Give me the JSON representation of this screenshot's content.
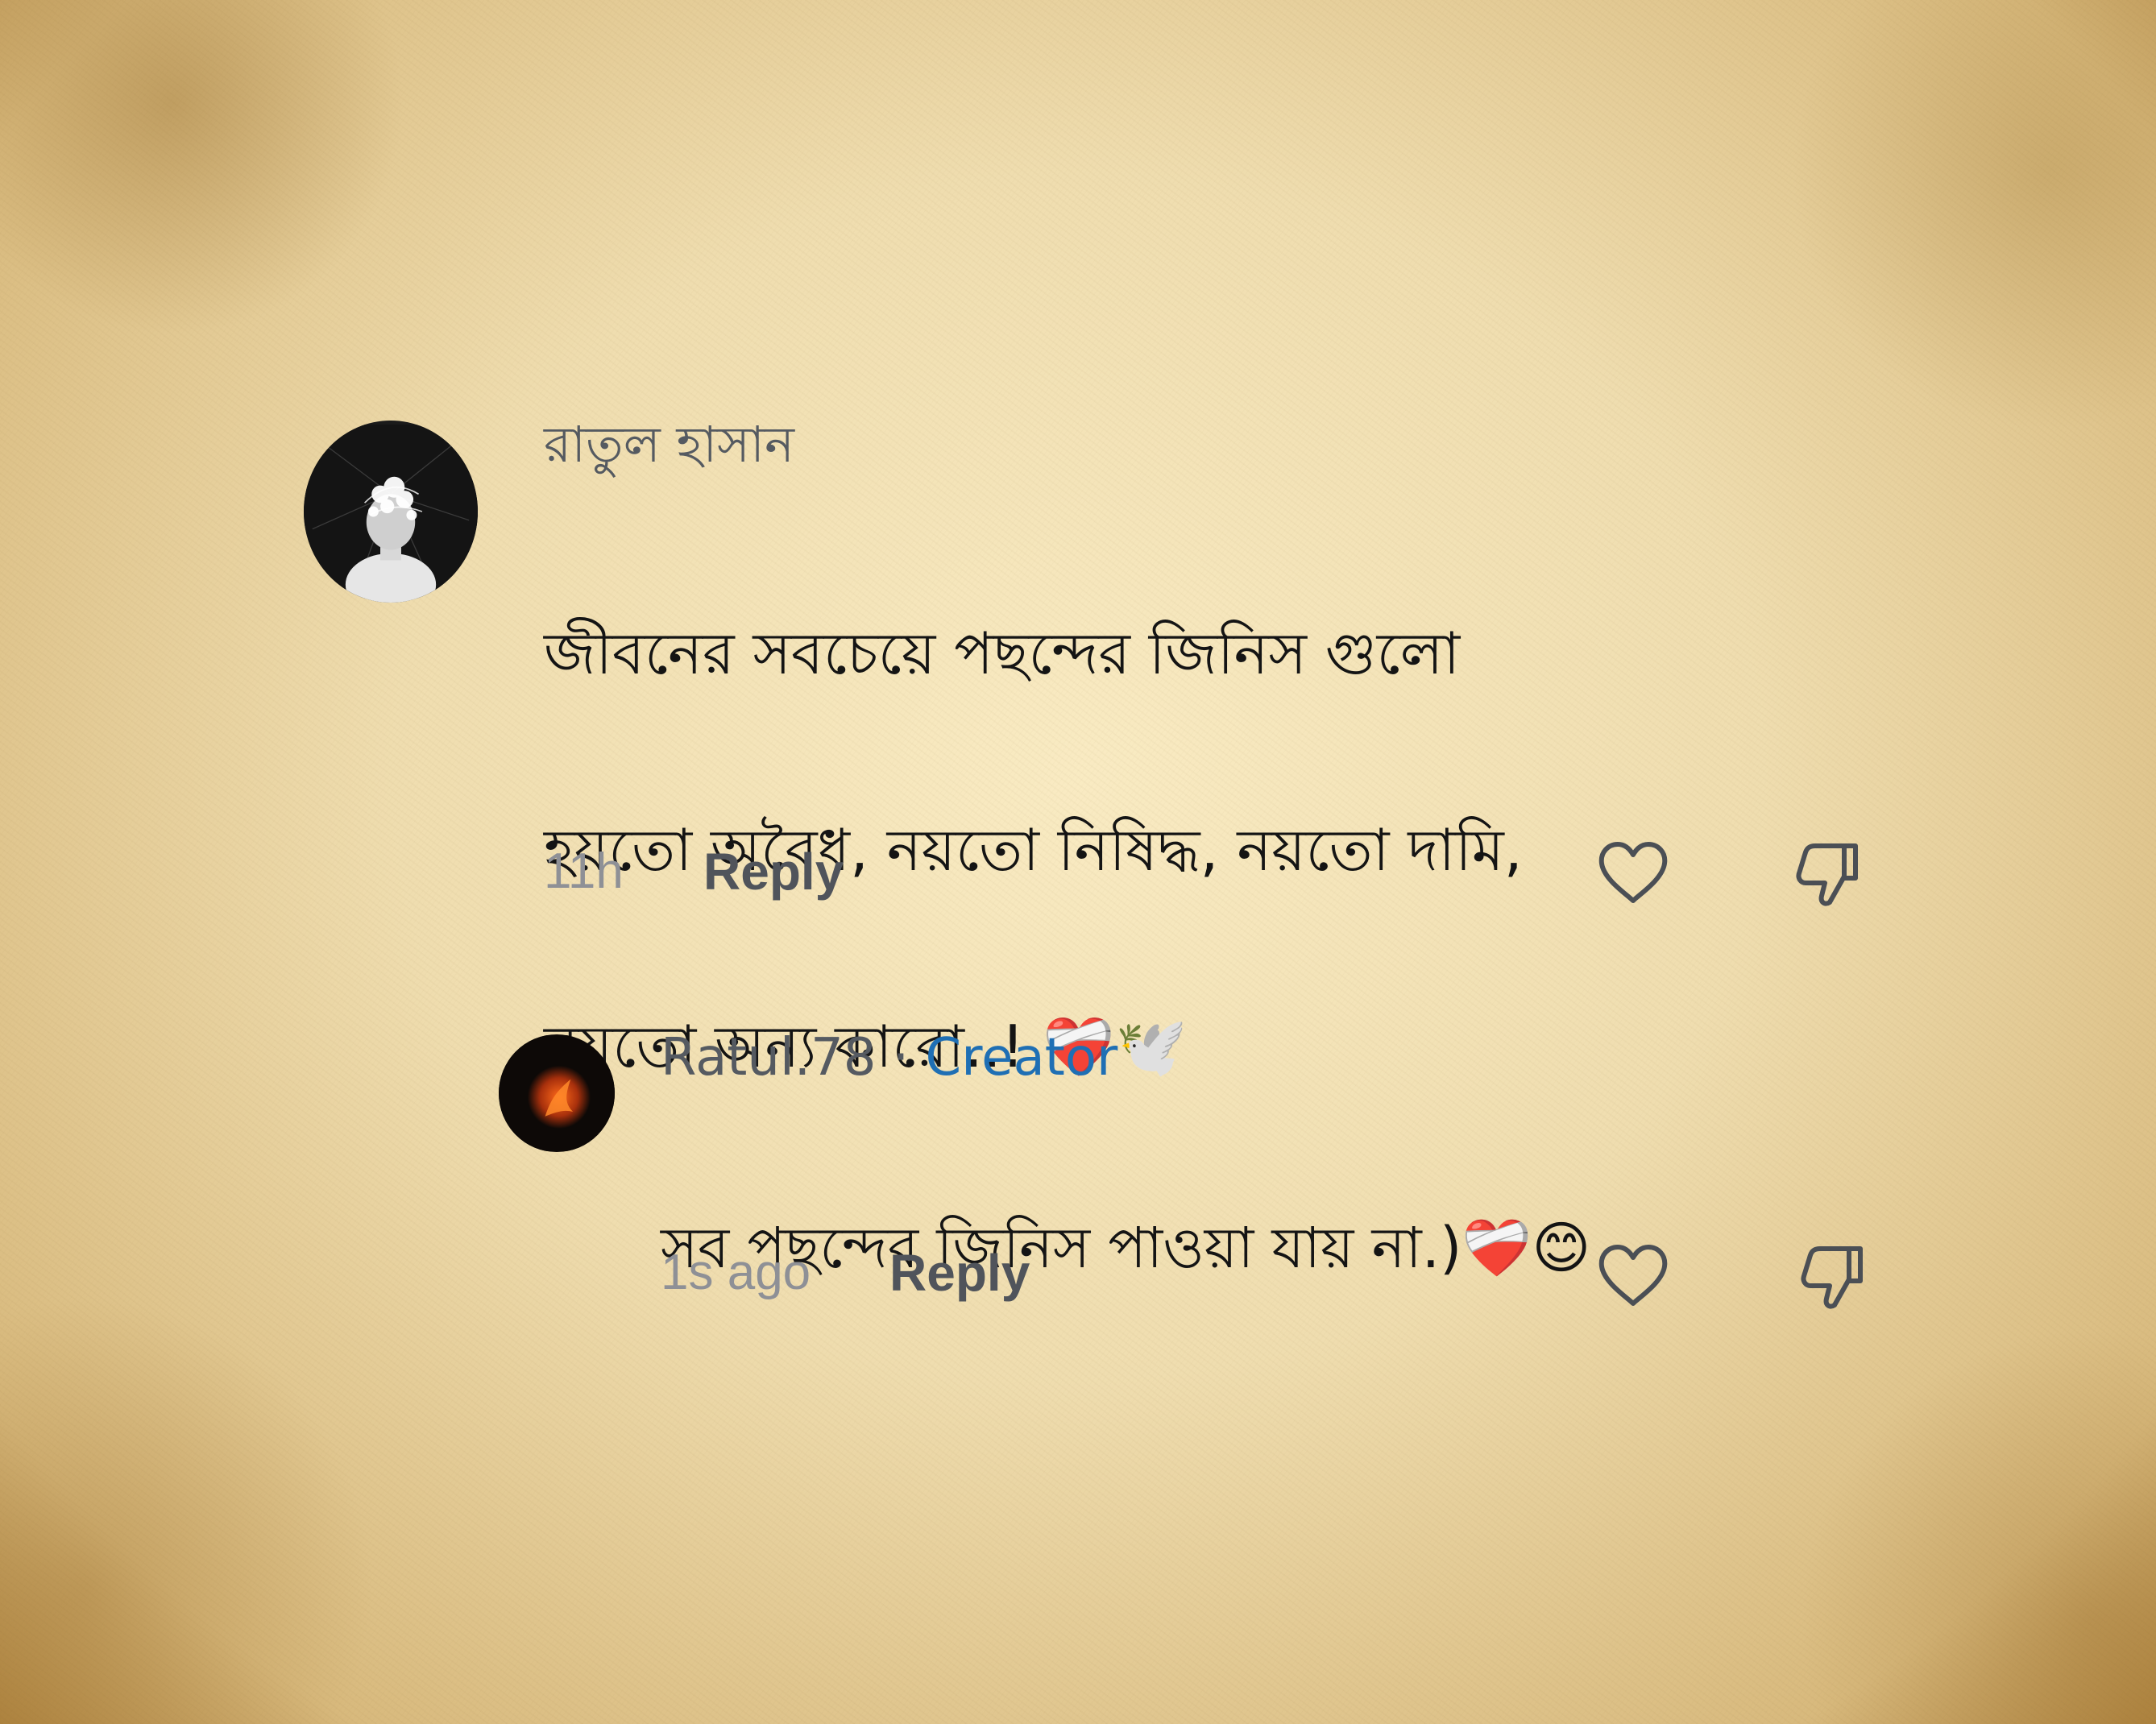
{
  "comments": [
    {
      "author": "রাতুল হাসান",
      "text_line1": "জীবনের সবচেয়ে পছন্দের জিনিস গুলো",
      "text_line2": "হয়তো অবৈধ, নয়তো নিষিদ্ধ, নয়তো দামি,",
      "text_line3": "নয়তো অন্য কারো..!",
      "text_emoji": "❤️‍🩹🕊️",
      "time": "11h",
      "reply_label": "Reply",
      "like_icon": "heart-outline-icon",
      "dislike_icon": "thumbs-down-outline-icon"
    }
  ],
  "replies": [
    {
      "author": "Ratul.78",
      "separator": "·",
      "badge": "Creator",
      "text": "সব পছন্দের জিনিস পাওয়া যায় না.)",
      "text_emoji": "❤️‍🩹😊",
      "time": "1s ago",
      "reply_label": "Reply",
      "like_icon": "heart-outline-icon",
      "dislike_icon": "thumbs-down-outline-icon"
    }
  ],
  "colors": {
    "background": "#ead7a8",
    "author_text": "#555a61",
    "body_text": "#141414",
    "creator_badge": "#1f6fb4",
    "timestamp": "#8e9096"
  }
}
